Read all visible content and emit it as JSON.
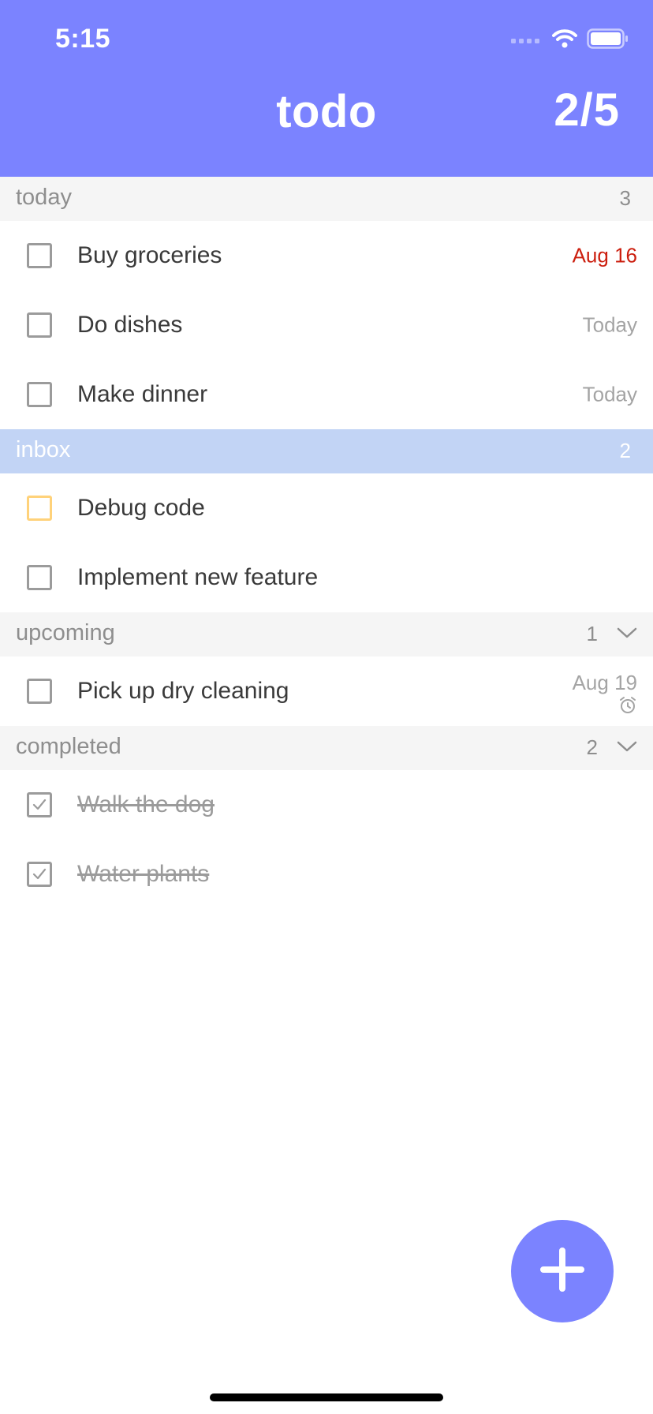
{
  "status_bar": {
    "time": "5:15"
  },
  "header": {
    "title": "todo",
    "progress": "2/5",
    "background": "#7b83ff"
  },
  "sections": {
    "today": {
      "title": "today",
      "count": "3",
      "items": [
        {
          "label": "Buy groceries",
          "date": "Aug 16",
          "overdue": true
        },
        {
          "label": "Do dishes",
          "date": "Today"
        },
        {
          "label": "Make dinner",
          "date": "Today"
        }
      ]
    },
    "inbox": {
      "title": "inbox",
      "count": "2",
      "selected": true,
      "items": [
        {
          "label": "Debug code",
          "checkbox_color": "#ffd27a"
        },
        {
          "label": "Implement new feature"
        }
      ]
    },
    "upcoming": {
      "title": "upcoming",
      "count": "1",
      "items": [
        {
          "label": "Pick up dry cleaning",
          "date": "Aug 19",
          "icon": "alarm-clock-icon"
        }
      ]
    },
    "completed": {
      "title": "completed",
      "count": "2",
      "items": [
        {
          "label": "Walk the dog",
          "checked": true
        },
        {
          "label": "Water plants",
          "checked": true
        }
      ]
    }
  },
  "fab": {
    "icon": "plus-icon"
  },
  "colors": {
    "accent": "#7b83ff",
    "overdue": "#cc1f0f",
    "selected_section": "#c2d4f5"
  }
}
